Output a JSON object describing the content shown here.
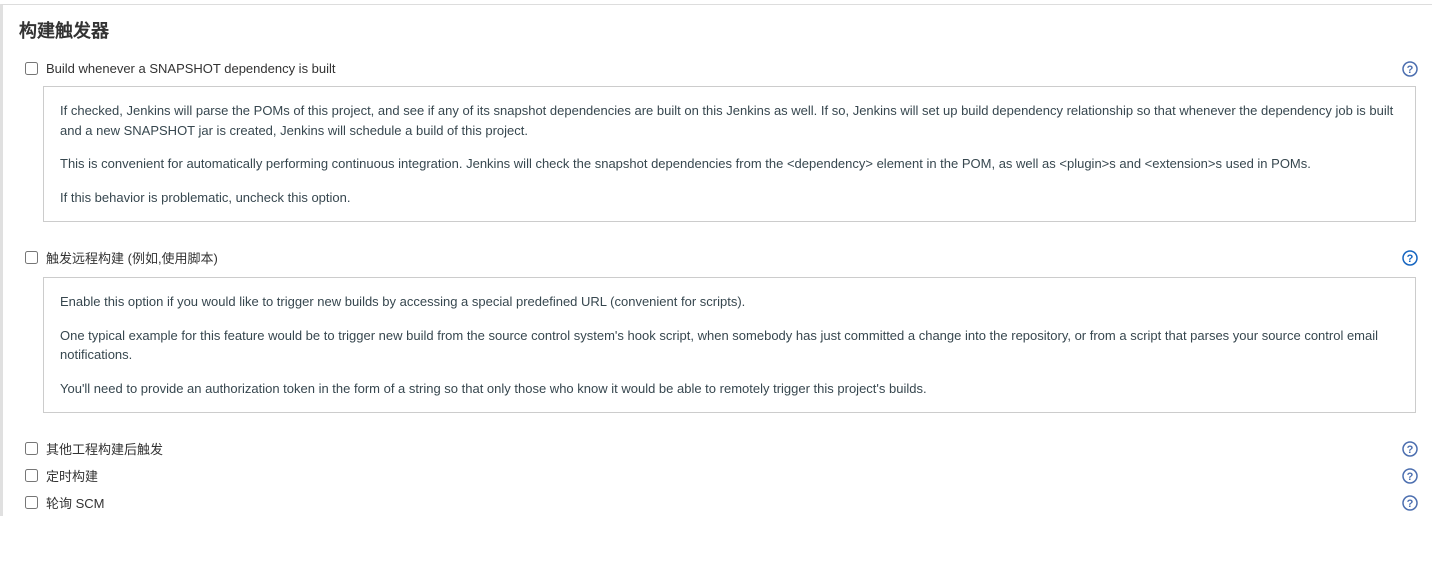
{
  "section": {
    "heading": "构建触发器",
    "triggers": [
      {
        "label": "Build whenever a SNAPSHOT dependency is built",
        "helpParagraphs": [
          "If checked, Jenkins will parse the POMs of this project, and see if any of its snapshot dependencies are built on this Jenkins as well. If so, Jenkins will set up build dependency relationship so that whenever the dependency job is built and a new SNAPSHOT jar is created, Jenkins will schedule a build of this project.",
          "This is convenient for automatically performing continuous integration. Jenkins will check the snapshot dependencies from the <dependency> element in the POM, as well as <plugin>s and <extension>s used in POMs.",
          "If this behavior is problematic, uncheck this option."
        ]
      },
      {
        "label": "触发远程构建 (例如,使用脚本)",
        "helpParagraphs": [
          "Enable this option if you would like to trigger new builds by accessing a special predefined URL (convenient for scripts).",
          "One typical example for this feature would be to trigger new build from the source control system's hook script, when somebody has just committed a change into the repository, or from a script that parses your source control email notifications.",
          "You'll need to provide an authorization token in the form of a string so that only those who know it would be able to remotely trigger this project's builds."
        ]
      },
      {
        "label": "其他工程构建后触发"
      },
      {
        "label": "定时构建"
      },
      {
        "label": "轮询 SCM"
      }
    ]
  }
}
